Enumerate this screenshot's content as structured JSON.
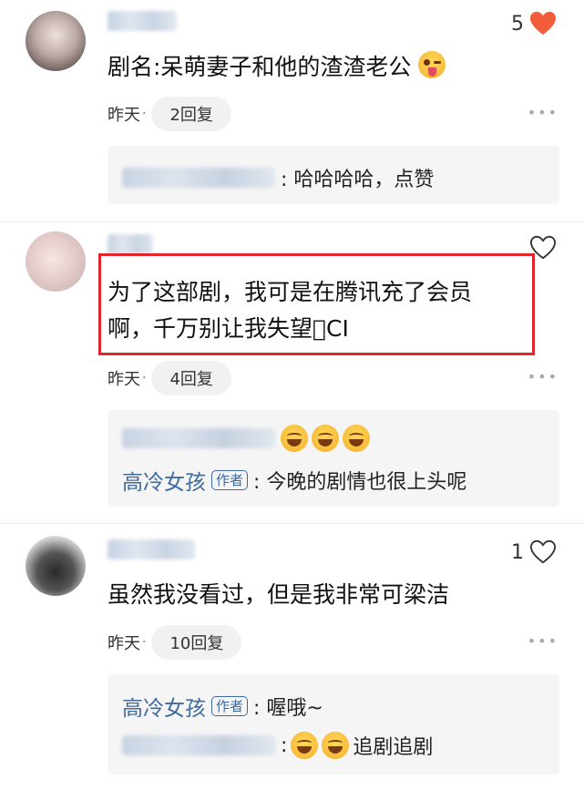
{
  "comments": [
    {
      "avatar": "user-avatar-1",
      "text": "剧名:呆萌妻子和他的渣渣老公",
      "emoji": "winking-face-with-tongue",
      "time": "昨天",
      "reply_count": "2回复",
      "likes": "5",
      "liked": true,
      "replies": [
        {
          "text": ": 哈哈哈哈，点赞"
        }
      ]
    },
    {
      "avatar": "user-avatar-2",
      "text_line1": "为了这部剧，我可是在腾讯充了会员",
      "text_line2": "啊，千万别让我失望\u0000CI",
      "time": "昨天",
      "reply_count": "4回复",
      "liked": false,
      "replies": [
        {
          "text": ""
        },
        {
          "name": "高冷女孩",
          "tag": "作者",
          "text": ": 今晚的剧情也很上头呢"
        }
      ]
    },
    {
      "avatar": "user-avatar-3",
      "text": "虽然我没看过，但是我非常可梁洁",
      "time": "昨天",
      "reply_count": "10回复",
      "likes": "1",
      "liked": false,
      "replies": [
        {
          "name": "高冷女孩",
          "tag": "作者",
          "text": ": 喔哦~"
        },
        {
          "text": "追剧追剧"
        }
      ]
    }
  ],
  "colors": {
    "like_red": "#f25c3a",
    "author_blue": "#3f6aa0",
    "highlight_red": "#e3262c"
  },
  "icons": {
    "like": "heart-icon",
    "more": "more-dots-icon"
  }
}
